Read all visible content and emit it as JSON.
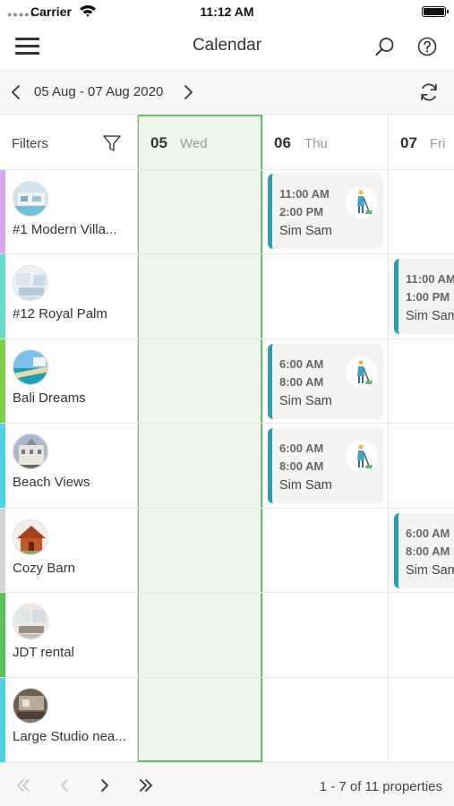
{
  "status_bar": {
    "carrier": "Carrier",
    "time": "11:12 AM",
    "signal": "●●●●●"
  },
  "header": {
    "title": "Calendar",
    "menu_icon": "hamburger-icon",
    "search_icon": "search-icon",
    "help_icon": "help-circle-icon"
  },
  "date_bar": {
    "range": "05 Aug - 07 Aug 2020",
    "prev_icon": "chevron-left-icon",
    "next_icon": "chevron-right-icon",
    "refresh_icon": "refresh-icon"
  },
  "filters": {
    "label": "Filters",
    "icon": "filter-icon"
  },
  "days": [
    {
      "num": "05",
      "name": "Wed",
      "selected": true
    },
    {
      "num": "06",
      "name": "Thu"
    },
    {
      "num": "07",
      "name": "Fri"
    }
  ],
  "properties": [
    {
      "name": "#1 Modern Villa...",
      "stripe": "#d9a9ee"
    },
    {
      "name": "#12 Royal Palm",
      "stripe": "#6fd9c9"
    },
    {
      "name": "Bali Dreams",
      "stripe": "#7fcf4e"
    },
    {
      "name": "Beach Views",
      "stripe": "#4fd1e0"
    },
    {
      "name": "Cozy Barn",
      "stripe": "#d4d4d4"
    },
    {
      "name": "JDT rental",
      "stripe": "#5cbf5a"
    },
    {
      "name": "Large Studio nea...",
      "stripe": "#4fd1e0"
    }
  ],
  "events": [
    {
      "start": "11:00 AM",
      "end": "2:00 PM",
      "assignee": "Sim  Sam",
      "icon": "cleaning-icon"
    },
    {
      "start": "11:00 AM",
      "end": "1:00 PM",
      "assignee": "Sim  Sam",
      "icon": "cleaning-icon"
    },
    {
      "start": "6:00 AM",
      "end": "8:00 AM",
      "assignee": "Sim  Sam",
      "icon": "cleaning-icon"
    },
    {
      "start": "6:00 AM",
      "end": "8:00 AM",
      "assignee": "Sim  Sam",
      "icon": "cleaning-icon"
    },
    {
      "start": "6:00 AM",
      "end": "8:00 AM",
      "assignee": "Sim  Sam",
      "icon": "cleaning-icon"
    }
  ],
  "pagination": {
    "summary": "1 - 7 of 11 properties",
    "first_icon": "double-chevron-left-icon",
    "prev_icon": "chevron-left-icon",
    "next_icon": "chevron-right-icon",
    "last_icon": "double-chevron-right-icon"
  },
  "colors": {
    "accent": "#2a9db0",
    "selected_border": "#6abf69",
    "selected_fill": "#eef6ee"
  }
}
